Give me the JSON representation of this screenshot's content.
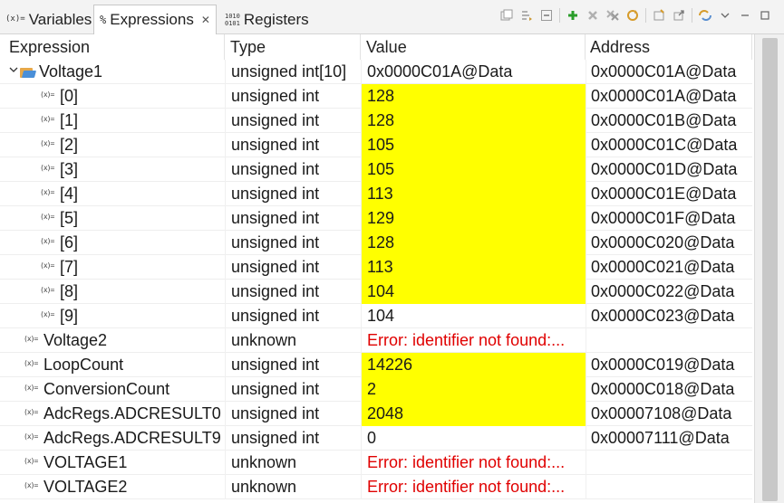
{
  "tabs": [
    {
      "label": "Variables",
      "icon": "(x)="
    },
    {
      "label": "Expressions",
      "icon": "%"
    },
    {
      "label": "Registers",
      "icon": "1010\n0101"
    }
  ],
  "tab_close_glyph": "✕",
  "toolbar_icons": [
    "collapse-all-icon",
    "show-logical-icon",
    "minimize-icon",
    "add-expression-icon",
    "remove-icon",
    "remove-all-icon",
    "refresh-icon",
    "new-watch-icon",
    "export-icon",
    "sync-icon",
    "view-menu-icon",
    "minimize-view-icon",
    "maximize-view-icon"
  ],
  "columns": {
    "expression": "Expression",
    "type": "Type",
    "value": "Value",
    "address": "Address"
  },
  "colors": {
    "highlight": "#ffff00",
    "error": "#e00000"
  },
  "rows": [
    {
      "expr": "Voltage1",
      "type": "unsigned int[10]",
      "value": "0x0000C01A@Data",
      "address": "0x0000C01A@Data",
      "level": 0,
      "expanded": true,
      "icon": "array-folder-icon",
      "hl": false,
      "err": false
    },
    {
      "expr": "[0]",
      "type": "unsigned int",
      "value": "128",
      "address": "0x0000C01A@Data",
      "level": 1,
      "icon": "variable-icon",
      "hl": true,
      "err": false
    },
    {
      "expr": "[1]",
      "type": "unsigned int",
      "value": "128",
      "address": "0x0000C01B@Data",
      "level": 1,
      "icon": "variable-icon",
      "hl": true,
      "err": false
    },
    {
      "expr": "[2]",
      "type": "unsigned int",
      "value": "105",
      "address": "0x0000C01C@Data",
      "level": 1,
      "icon": "variable-icon",
      "hl": true,
      "err": false
    },
    {
      "expr": "[3]",
      "type": "unsigned int",
      "value": "105",
      "address": "0x0000C01D@Data",
      "level": 1,
      "icon": "variable-icon",
      "hl": true,
      "err": false
    },
    {
      "expr": "[4]",
      "type": "unsigned int",
      "value": "113",
      "address": "0x0000C01E@Data",
      "level": 1,
      "icon": "variable-icon",
      "hl": true,
      "err": false
    },
    {
      "expr": "[5]",
      "type": "unsigned int",
      "value": "129",
      "address": "0x0000C01F@Data",
      "level": 1,
      "icon": "variable-icon",
      "hl": true,
      "err": false
    },
    {
      "expr": "[6]",
      "type": "unsigned int",
      "value": "128",
      "address": "0x0000C020@Data",
      "level": 1,
      "icon": "variable-icon",
      "hl": true,
      "err": false
    },
    {
      "expr": "[7]",
      "type": "unsigned int",
      "value": "113",
      "address": "0x0000C021@Data",
      "level": 1,
      "icon": "variable-icon",
      "hl": true,
      "err": false
    },
    {
      "expr": "[8]",
      "type": "unsigned int",
      "value": "104",
      "address": "0x0000C022@Data",
      "level": 1,
      "icon": "variable-icon",
      "hl": true,
      "err": false
    },
    {
      "expr": "[9]",
      "type": "unsigned int",
      "value": "104",
      "address": "0x0000C023@Data",
      "level": 1,
      "icon": "variable-icon",
      "hl": false,
      "err": false
    },
    {
      "expr": "Voltage2",
      "type": "unknown",
      "value": "Error: identifier not found:...",
      "address": "",
      "level": 0,
      "icon": "variable-icon",
      "hl": false,
      "err": true
    },
    {
      "expr": "LoopCount",
      "type": "unsigned int",
      "value": "14226",
      "address": "0x0000C019@Data",
      "level": 0,
      "icon": "variable-icon",
      "hl": true,
      "err": false
    },
    {
      "expr": "ConversionCount",
      "type": "unsigned int",
      "value": "2",
      "address": "0x0000C018@Data",
      "level": 0,
      "icon": "variable-icon",
      "hl": true,
      "err": false
    },
    {
      "expr": "AdcRegs.ADCRESULT0",
      "type": "unsigned int",
      "value": "2048",
      "address": "0x00007108@Data",
      "level": 0,
      "icon": "variable-icon",
      "hl": true,
      "err": false
    },
    {
      "expr": "AdcRegs.ADCRESULT9",
      "type": "unsigned int",
      "value": "0",
      "address": "0x00007111@Data",
      "level": 0,
      "icon": "variable-icon",
      "hl": false,
      "err": false
    },
    {
      "expr": "VOLTAGE1",
      "type": "unknown",
      "value": "Error: identifier not found:...",
      "address": "",
      "level": 0,
      "icon": "variable-icon",
      "hl": false,
      "err": true
    },
    {
      "expr": "VOLTAGE2",
      "type": "unknown",
      "value": "Error: identifier not found:...",
      "address": "",
      "level": 0,
      "icon": "variable-icon",
      "hl": false,
      "err": true
    }
  ]
}
